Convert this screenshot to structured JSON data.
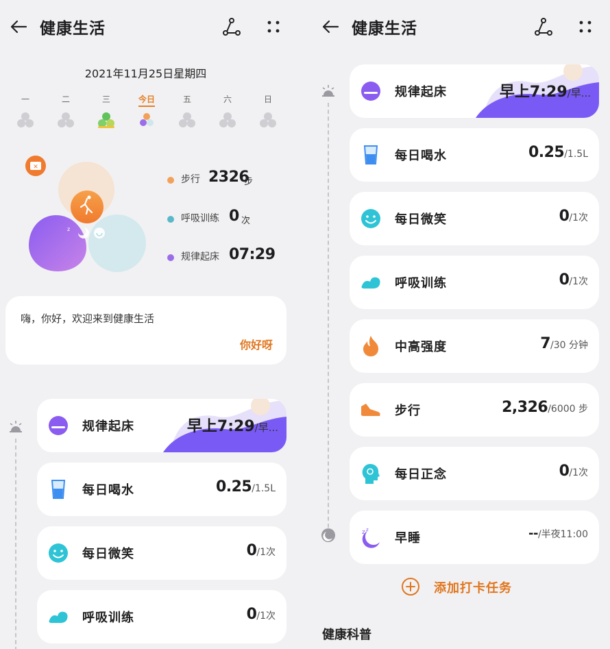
{
  "header": {
    "title": "健康生活"
  },
  "date": "2021年11月25日星期四",
  "week": [
    {
      "label": "一"
    },
    {
      "label": "二"
    },
    {
      "label": "三"
    },
    {
      "label": "今日"
    },
    {
      "label": "五"
    },
    {
      "label": "六"
    },
    {
      "label": "日"
    }
  ],
  "stats": [
    {
      "label": "步行",
      "value": "2326",
      "unit": "步",
      "color": "#f2a15a"
    },
    {
      "label": "呼吸训练",
      "value": "0",
      "unit": "次",
      "color": "#5bb8c9"
    },
    {
      "label": "规律起床",
      "value": "07:29",
      "unit": "",
      "color": "#9b6de8"
    }
  ],
  "greeting": {
    "text": "嗨，你好，欢迎来到健康生活",
    "button": "你好呀"
  },
  "tasks": [
    {
      "name": "规律起床",
      "time": "早上7:29",
      "suffix": "/早...",
      "icon": "alarm-clock-icon"
    },
    {
      "name": "每日喝水",
      "value": "0.25",
      "target": "/1.5L",
      "icon": "water-cup-icon"
    },
    {
      "name": "每日微笑",
      "value": "0",
      "target": "/1次",
      "icon": "smile-icon"
    },
    {
      "name": "呼吸训练",
      "value": "0",
      "target": "/1次",
      "icon": "breath-cloud-icon"
    },
    {
      "name": "中高强度",
      "value": "7",
      "target": "/30 分钟",
      "icon": "flame-icon"
    },
    {
      "name": "步行",
      "value": "2,326",
      "target": "/6000 步",
      "icon": "shoe-icon"
    },
    {
      "name": "每日正念",
      "value": "0",
      "target": "/1次",
      "icon": "mindfulness-head-icon"
    },
    {
      "name": "早睡",
      "value": "--",
      "target": "/半夜11:00",
      "icon": "sleep-moon-icon"
    }
  ],
  "add_task": "添加打卡任务",
  "section": "健康科普",
  "colors": {
    "accent": "#e0761e",
    "purple": "#7a5af5",
    "cyan": "#2ec4d6"
  }
}
